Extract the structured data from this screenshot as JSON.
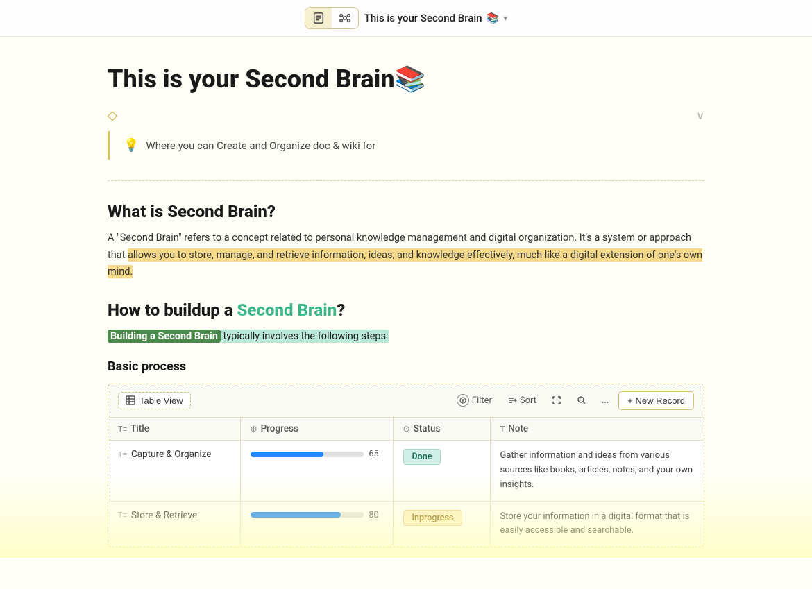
{
  "nav": {
    "title": "This is your Second Brain",
    "emoji": "📚",
    "chevron": "▾",
    "icon1_label": "document-icon",
    "icon2_label": "graph-icon"
  },
  "page": {
    "title": "This is your Second Brain📚",
    "tags_icon": "◇",
    "callout_emoji": "💡",
    "callout_text": "Where you can Create and Organize doc & wiki  for",
    "section1_heading": "What is Second Brain?",
    "section1_para1": "A \"Second Brain\" refers to a concept related to personal knowledge management and digital organization. It's a system or approach that ",
    "section1_highlight": "allows you to store, manage, and retrieve information, ideas, and knowledge effectively, much like a digital extension of one's own mind.",
    "section2_heading_pre": "How to buildup a ",
    "section2_heading_teal": "Second Brain",
    "section2_heading_post": "?",
    "building_bold": "Building a Second Brain",
    "building_rest": " typically involves the following steps:",
    "basic_process_heading": "Basic process",
    "toolbar": {
      "table_view_label": "Table View",
      "filter_label": "Filter",
      "sort_label": "Sort",
      "expand_label": "",
      "search_label": "",
      "more_label": "...",
      "new_record_label": "+ New Record"
    },
    "table": {
      "headers": [
        "Title",
        "Progress",
        "Status",
        "Note"
      ],
      "header_icons": [
        "T≡",
        "⊕",
        "⊙",
        "T"
      ],
      "rows": [
        {
          "title": "Capture & Organize",
          "progress": 65,
          "status": "Done",
          "status_type": "done",
          "note": "Gather information and ideas from various sources like books, articles, notes, and your own insights."
        },
        {
          "title": "Store & Retrieve",
          "progress": 80,
          "status": "Inprogress",
          "status_type": "inprogress",
          "note": "Store your information in a digital format that is easily accessible and searchable."
        }
      ]
    }
  }
}
